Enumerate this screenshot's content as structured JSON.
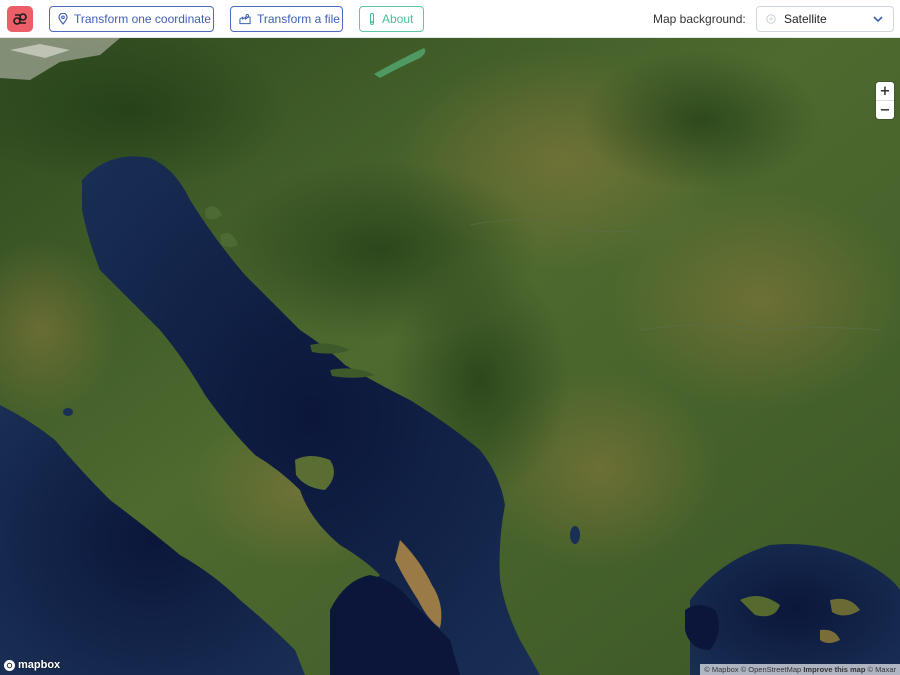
{
  "toolbar": {
    "transform_coordinate_label": "Transform one coordinate",
    "transform_file_label": "Transform a file",
    "about_label": "About",
    "background_label": "Map background:",
    "background_value": "Satellite"
  },
  "map": {
    "zoom_in": "+",
    "zoom_out": "−",
    "logo_text": "mapbox",
    "attribution": {
      "mapbox": "© Mapbox",
      "sep1": "©",
      "osm": "OpenStreetMap",
      "improve": "Improve this map",
      "sep2": "©",
      "maxar": "Maxar"
    }
  },
  "colors": {
    "logo_bg": "#ec5f68",
    "primary": "#4d6bbf",
    "about": "#5fc7a6",
    "land": "#40572a",
    "sea": "#0d1a3b"
  },
  "icons": {
    "logo": "app-logo-icon",
    "coordinate": "location-pin-icon",
    "file": "file-transform-icon",
    "about": "info-icon",
    "background": "globe-icon",
    "dropdown": "chevron-down-icon"
  }
}
